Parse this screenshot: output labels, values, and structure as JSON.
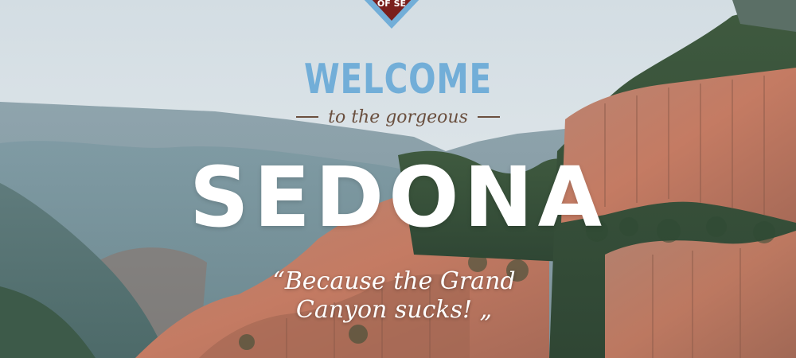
{
  "hero": {
    "badge_text": "OF SE",
    "welcome": "WELCOME",
    "subtitle": "to the gorgeous",
    "city": "SEDONA",
    "quote_open": "“",
    "quote_line1": "Because the Grand",
    "quote_line2": "Canyon sucks!",
    "quote_close": "„"
  },
  "colors": {
    "welcome": "#72aed8",
    "subtitle": "#6a4f3e",
    "badge_border": "#72aed8",
    "badge_fill": "#7a1f1c"
  }
}
